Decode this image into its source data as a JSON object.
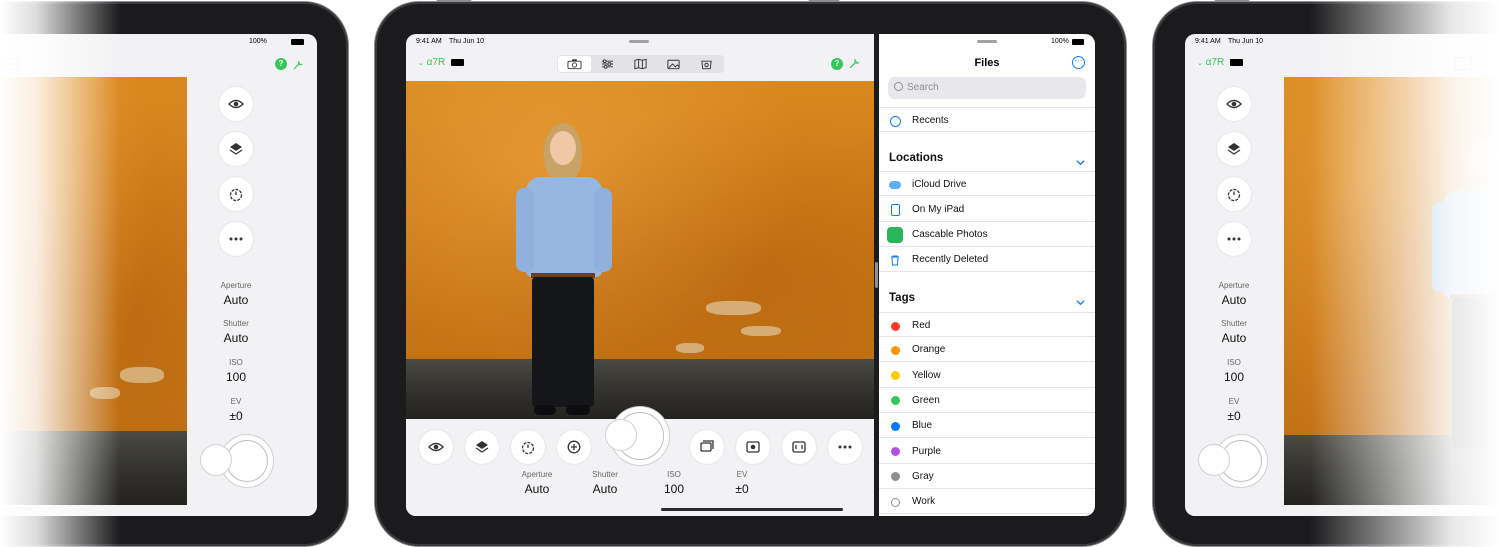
{
  "status_bar": {
    "time": "9:41 AM",
    "date": "Thu Jun 10",
    "battery": "100%"
  },
  "camera": {
    "name": "α7R",
    "help_badge": "?",
    "toolbar_tabs": [
      "camera-icon",
      "sliders-icon",
      "map-icon",
      "photos-icon",
      "bag-icon"
    ],
    "active_tab": 0
  },
  "controls": {
    "buttons": [
      "eye-icon",
      "layers-icon",
      "timer-icon",
      "stabilize-icon",
      "gallery-icon",
      "live-view-icon",
      "focus-icon",
      "more-icon"
    ]
  },
  "exposure": [
    {
      "label": "Aperture",
      "value": "Auto"
    },
    {
      "label": "Shutter",
      "value": "Auto"
    },
    {
      "label": "ISO",
      "value": "100"
    },
    {
      "label": "EV",
      "value": "±0"
    }
  ],
  "files": {
    "title": "Files",
    "search_placeholder": "Search",
    "recents": "Recents",
    "locations_title": "Locations",
    "locations": [
      {
        "label": "iCloud Drive",
        "icon": "cloud-icon"
      },
      {
        "label": "On My iPad",
        "icon": "ipad-icon"
      },
      {
        "label": "Cascable Photos",
        "icon": "cascable-icon"
      },
      {
        "label": "Recently Deleted",
        "icon": "trash-icon"
      }
    ],
    "tags_title": "Tags",
    "tags": [
      {
        "label": "Red",
        "color": "#ff3b30"
      },
      {
        "label": "Orange",
        "color": "#ff9500"
      },
      {
        "label": "Yellow",
        "color": "#ffcc00"
      },
      {
        "label": "Green",
        "color": "#34c759"
      },
      {
        "label": "Blue",
        "color": "#007aff"
      },
      {
        "label": "Purple",
        "color": "#af52de"
      },
      {
        "label": "Gray",
        "color": "#8e8e93"
      },
      {
        "label": "Work",
        "color": "#ffffff"
      }
    ]
  },
  "colors": {
    "accent_blue": "#0a7aff",
    "camera_green": "#34c759",
    "bezel": "#1b1b1d"
  }
}
